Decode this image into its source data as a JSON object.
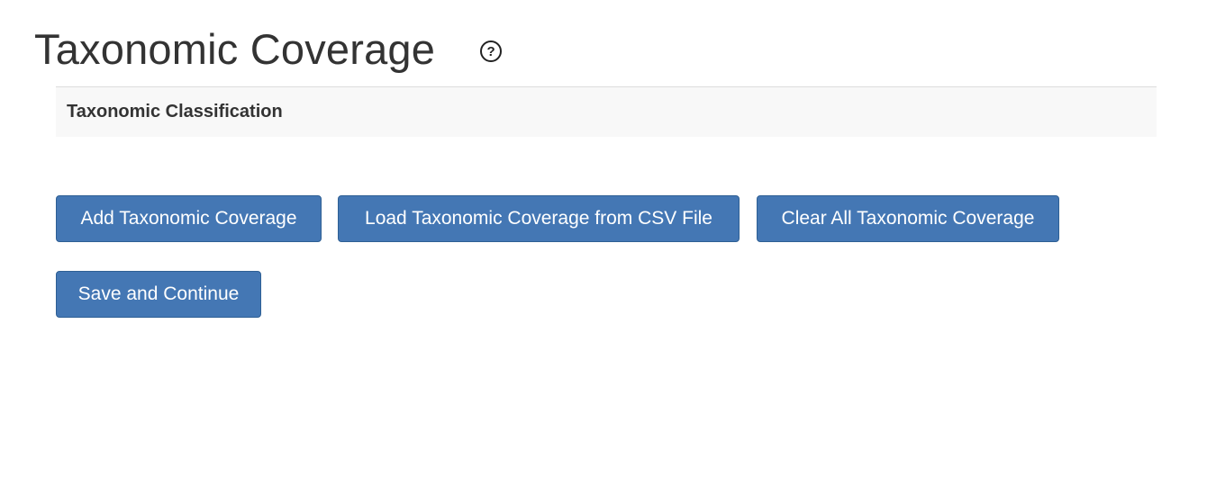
{
  "header": {
    "title": "Taxonomic Coverage",
    "help_icon": "question-circle-icon",
    "help_symbol": "?"
  },
  "section": {
    "title": "Taxonomic Classification"
  },
  "buttons": {
    "add": "Add Taxonomic Coverage",
    "load_csv": "Load Taxonomic Coverage from CSV File",
    "clear_all": "Clear All Taxonomic Coverage",
    "save_continue": "Save and Continue"
  },
  "colors": {
    "button_bg": "#4477b4",
    "button_border": "#2e5f94",
    "section_bg": "#f8f8f8"
  }
}
